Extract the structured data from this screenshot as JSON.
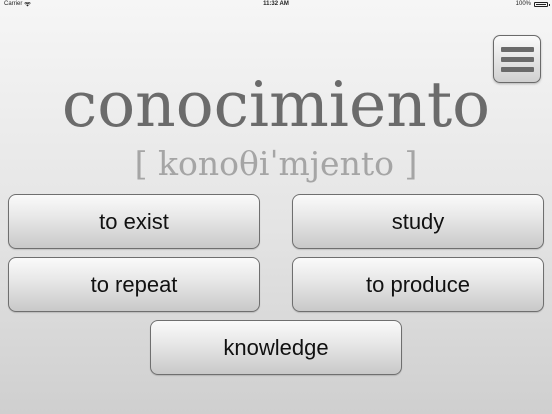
{
  "status_bar": {
    "carrier": "Carrier",
    "time": "11:32 AM",
    "battery": "100%"
  },
  "menu": {
    "icon": "hamburger-menu-icon"
  },
  "quiz": {
    "word": "conocimiento",
    "pronunciation": "[ konoθiˈmjento ]",
    "options": [
      "to exist",
      "study",
      "to repeat",
      "to produce",
      "knowledge"
    ]
  }
}
